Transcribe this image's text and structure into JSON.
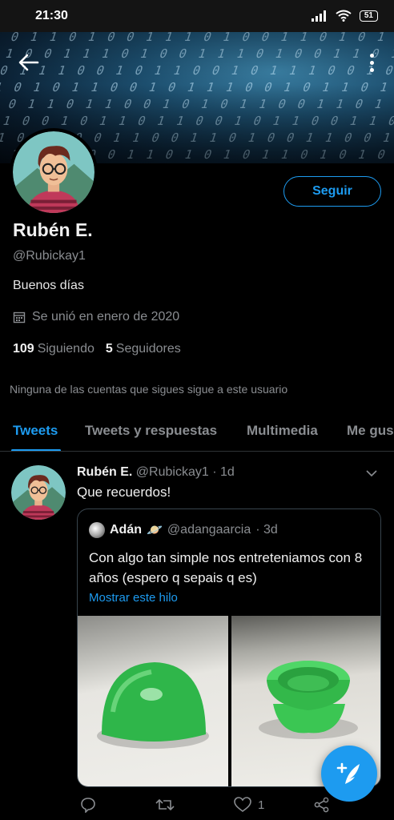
{
  "status_bar": {
    "time": "21:30",
    "battery": "51"
  },
  "profile": {
    "name": "Rubén E.",
    "handle": "@Rubickay1",
    "bio": "Buenos días",
    "joined": "Se unió en enero de 2020",
    "following_count": "109",
    "following_label": "Siguiendo",
    "followers_count": "5",
    "followers_label": "Seguidores",
    "follow_button": "Seguir",
    "followers_note": "Ninguna de las cuentas que sigues sigue a este usuario"
  },
  "tabs": [
    {
      "label": "Tweets"
    },
    {
      "label": "Tweets y respuestas"
    },
    {
      "label": "Multimedia"
    },
    {
      "label": "Me gus"
    }
  ],
  "tweet": {
    "author_name": "Rubén E.",
    "author_handle": "@Rubickay1",
    "time": "· 1d",
    "text": "Que recuerdos!",
    "quote": {
      "author_name": "Adán",
      "author_emoji": "🪐",
      "author_handle": "@adangaarcia",
      "time": "· 3d",
      "text": "Con algo tan simple nos entreteniamos con 8 años (espero q sepais q es)",
      "link": "Mostrar este hilo"
    },
    "like_count": "1"
  },
  "icons": {
    "back": "arrow-left-icon",
    "more": "more-vertical-icon",
    "calendar": "calendar-icon",
    "caret": "chevron-down-icon",
    "reply": "reply-icon",
    "retweet": "retweet-icon",
    "like": "heart-icon",
    "share": "share-icon",
    "compose": "compose-tweet-icon"
  },
  "colors": {
    "accent": "#1d9bf0",
    "background": "#000000",
    "muted": "#8a8d91"
  }
}
